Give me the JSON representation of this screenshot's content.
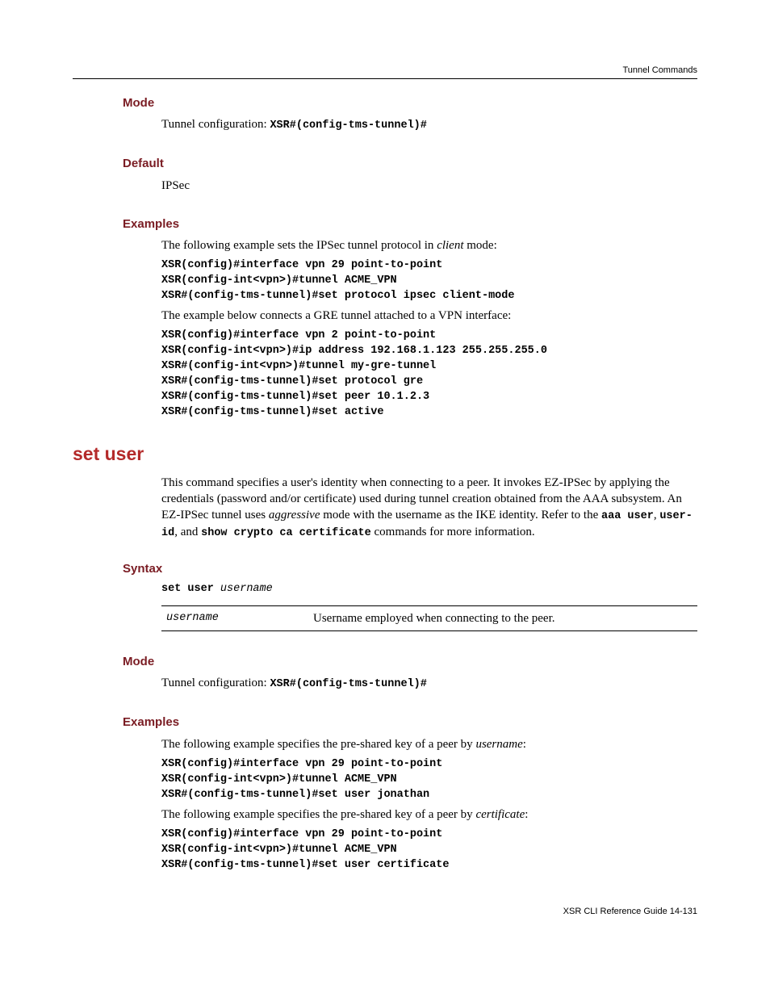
{
  "header": {
    "right": "Tunnel Commands"
  },
  "sec_mode1": {
    "title": "Mode",
    "text_prefix": "Tunnel configuration: ",
    "text_mono": "XSR#(config-tms-tunnel)#"
  },
  "sec_default": {
    "title": "Default",
    "text": "IPSec"
  },
  "sec_examples1": {
    "title": "Examples",
    "intro1_a": "The following example sets the IPSec tunnel protocol in ",
    "intro1_it": "client",
    "intro1_b": " mode:",
    "code1": "XSR(config)#interface vpn 29 point-to-point\nXSR(config-int<vpn>)#tunnel ACME_VPN\nXSR#(config-tms-tunnel)#set protocol ipsec client-mode",
    "intro2": "The example below connects a GRE tunnel attached to a VPN interface:",
    "code2": "XSR(config)#interface vpn 2 point-to-point\nXSR(config-int<vpn>)#ip address 192.168.1.123 255.255.255.0\nXSR#(config-int<vpn>)#tunnel my-gre-tunnel\nXSR#(config-tms-tunnel)#set protocol gre\nXSR#(config-tms-tunnel)#set peer 10.1.2.3\nXSR#(config-tms-tunnel)#set active"
  },
  "cmd_setuser": {
    "title": "set user",
    "desc_a": "This command specifies a user's identity when connecting to a peer. It invokes EZ-IPSec by applying the credentials (password and/or certificate) used during tunnel creation obtained from the AAA subsystem. An EZ-IPSec tunnel uses ",
    "desc_it": "aggressive",
    "desc_b": " mode with the username as the IKE identity. Refer to the ",
    "desc_m1": "aaa user",
    "desc_c": ", ",
    "desc_m2": "user-id",
    "desc_d": ", and ",
    "desc_m3": "show crypto ca certificate",
    "desc_e": " commands for more information."
  },
  "sec_syntax": {
    "title": "Syntax",
    "cmd": "set user",
    "arg": " username",
    "param_name": "username",
    "param_desc": "Username employed when connecting to the peer."
  },
  "sec_mode2": {
    "title": "Mode",
    "text_prefix": "Tunnel configuration: ",
    "text_mono": "XSR#(config-tms-tunnel)#"
  },
  "sec_examples2": {
    "title": "Examples",
    "intro1_a": "The following example specifies the pre-shared key of a peer by ",
    "intro1_it": "username",
    "intro1_b": ":",
    "code1": "XSR(config)#interface vpn 29 point-to-point\nXSR(config-int<vpn>)#tunnel ACME_VPN\nXSR#(config-tms-tunnel)#set user jonathan",
    "intro2_a": "The following example specifies the pre-shared key of a peer by ",
    "intro2_it": "certificate",
    "intro2_b": ":",
    "code2": "XSR(config)#interface vpn 29 point-to-point\nXSR(config-int<vpn>)#tunnel ACME_VPN\nXSR#(config-tms-tunnel)#set user certificate"
  },
  "footer": {
    "text": "XSR CLI Reference Guide   14-131"
  }
}
